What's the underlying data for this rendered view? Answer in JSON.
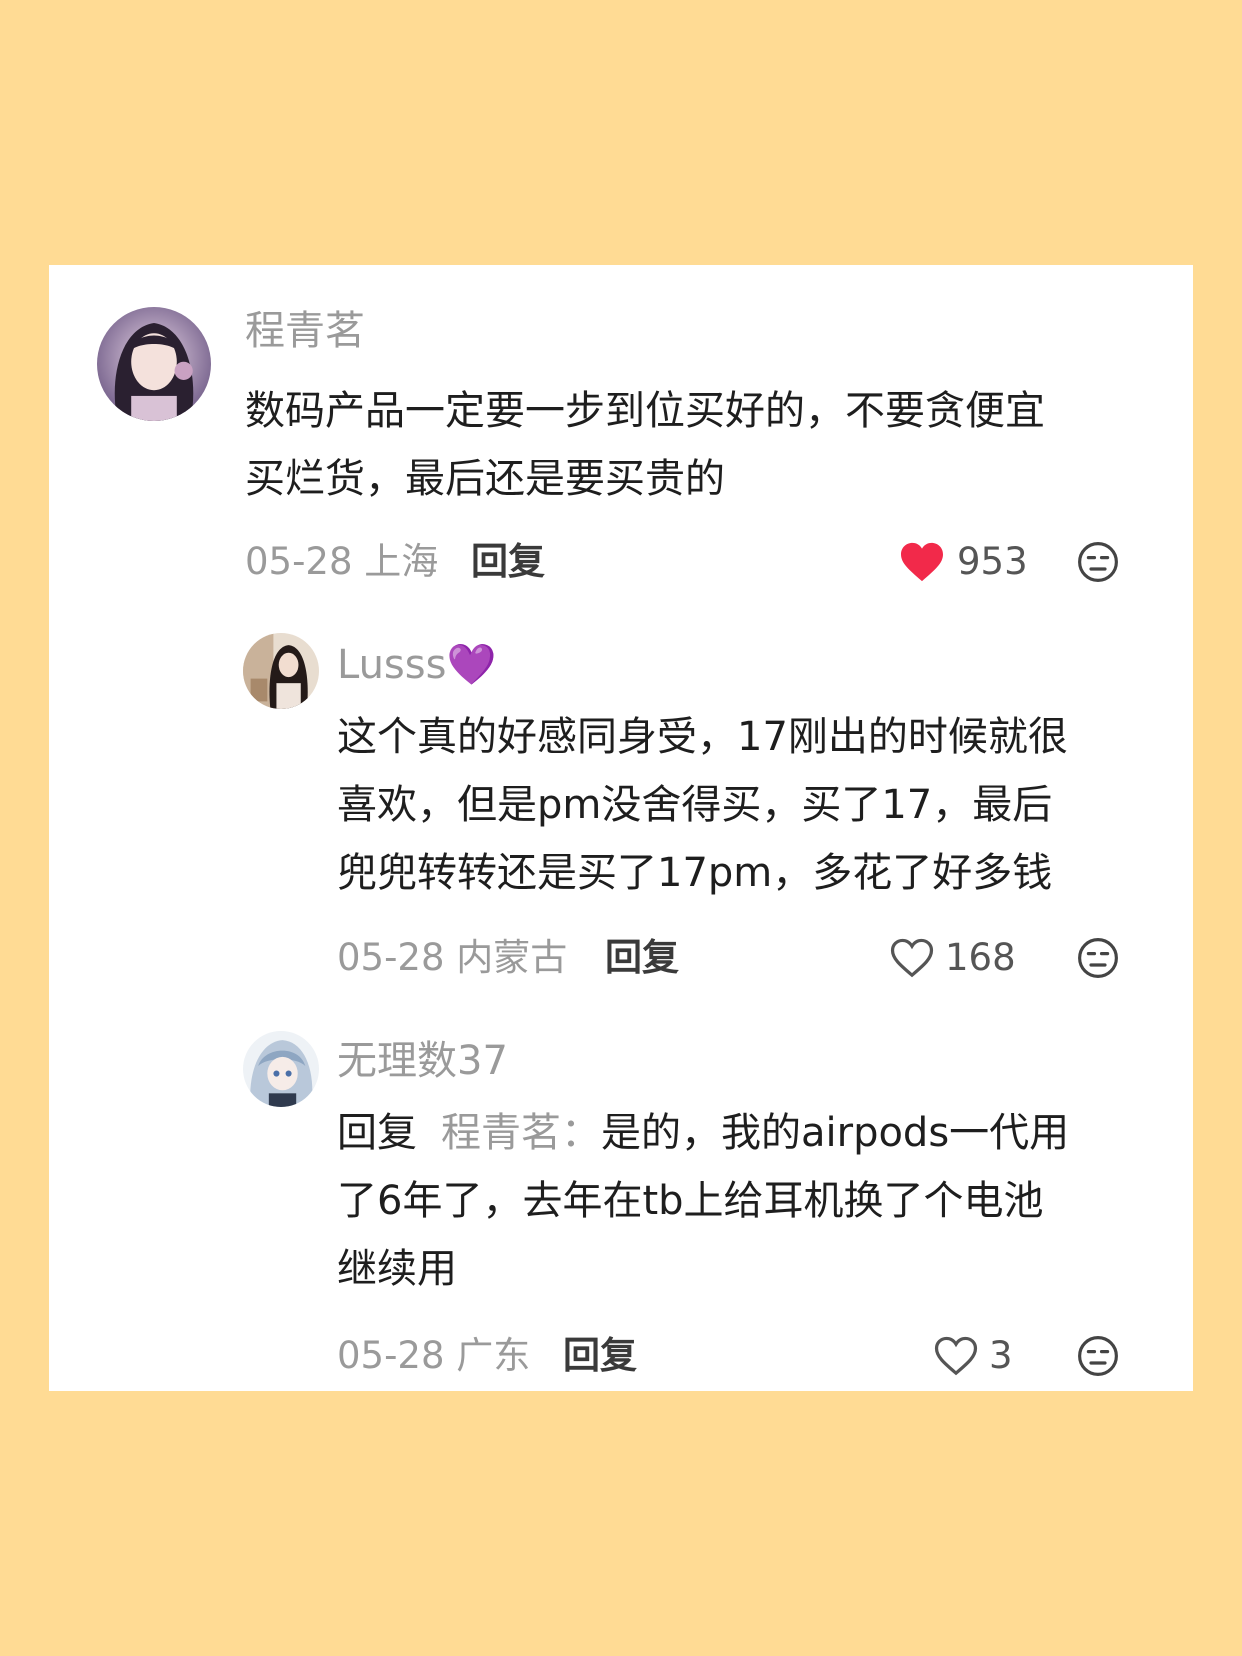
{
  "colors": {
    "background": "#FFDB94",
    "card": "#ffffff",
    "username": "#9a9a9a",
    "text": "#1e1e1e",
    "liked_heart": "#f2294a"
  },
  "comments": [
    {
      "username": "程青茗",
      "lines": [
        "数码产品一定要一步到位买好的，不要贪便宜",
        "买烂货，最后还是要买贵的"
      ],
      "date_location": "05-28 上海",
      "reply_label": "回复",
      "likes": "953",
      "liked": true,
      "like_icon": "heart-filled-icon",
      "dislike_icon": "meh-face-icon"
    },
    {
      "username": "Lusss💜",
      "lines": [
        "这个真的好感同身受，17刚出的时候就很",
        "喜欢，但是pm没舍得买，买了17，最后",
        "兜兜转转还是买了17pm，多花了好多钱"
      ],
      "date_location": "05-28 内蒙古",
      "reply_label": "回复",
      "likes": "168",
      "liked": false,
      "like_icon": "heart-outline-icon",
      "dislike_icon": "meh-face-icon"
    },
    {
      "username": "无理数37",
      "reply_prefix": "回复",
      "reply_target": "程青茗：",
      "first_line_rest": "是的，我的airpods一代用",
      "lines": [
        "了6年了，去年在tb上给耳机换了个电池",
        "继续用"
      ],
      "date_location": "05-28 广东",
      "reply_label": "回复",
      "likes": "3",
      "liked": false,
      "like_icon": "heart-outline-icon",
      "dislike_icon": "meh-face-icon"
    }
  ]
}
